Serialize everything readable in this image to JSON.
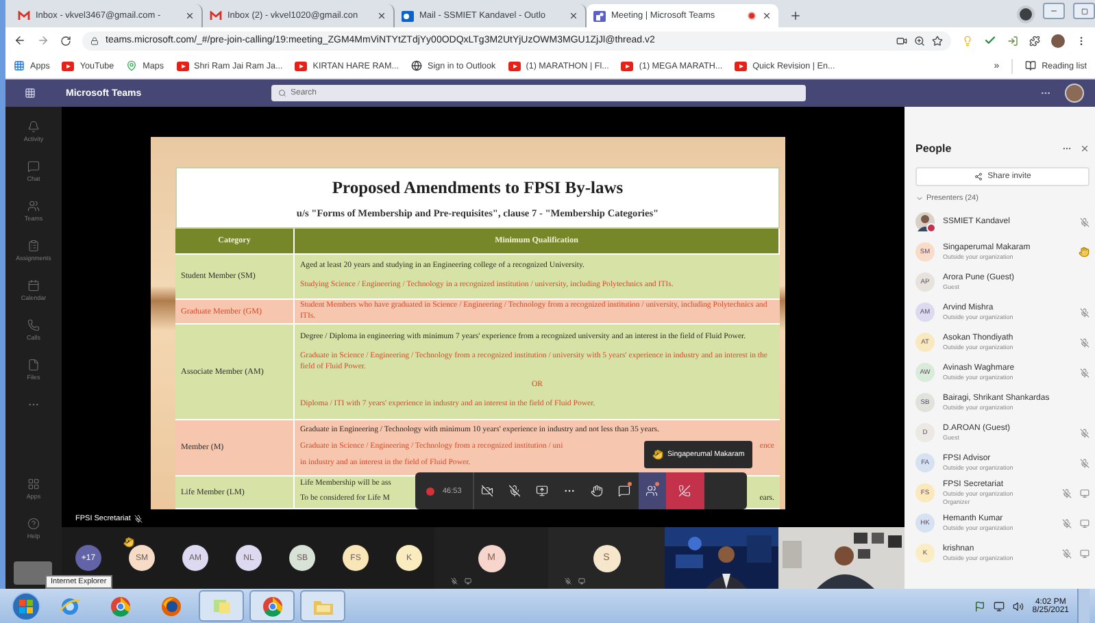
{
  "browser": {
    "tabs": [
      {
        "kind": "mail",
        "title": "Inbox - vkvel3467@gmail.com -",
        "selected": false,
        "recording": false
      },
      {
        "kind": "mail",
        "title": "Inbox (2) - vkvel1020@gmail.con",
        "selected": false,
        "recording": false
      },
      {
        "kind": "outlook",
        "title": "Mail - SSMIET Kandavel - Outlo",
        "selected": false,
        "recording": false
      },
      {
        "kind": "teams",
        "title": "Meeting | Microsoft Teams",
        "selected": true,
        "recording": true
      }
    ],
    "url": "teams.microsoft.com/_#/pre-join-calling/19:meeting_ZGM4MmViNTYtZTdjYy00ODQxLTg3M2UtYjUzOWM3MGU1ZjJl@thread.v2",
    "bookmarks": [
      {
        "kind": "apps",
        "label": "Apps"
      },
      {
        "kind": "youtube",
        "label": "YouTube"
      },
      {
        "kind": "maps",
        "label": "Maps"
      },
      {
        "kind": "youtube",
        "label": "Shri Ram Jai Ram Ja..."
      },
      {
        "kind": "youtube",
        "label": "KIRTAN HARE RAM..."
      },
      {
        "kind": "globe",
        "label": "Sign in to Outlook"
      },
      {
        "kind": "youtube",
        "label": "(1) MARATHON | Fl..."
      },
      {
        "kind": "youtube",
        "label": "(1) MEGA MARATH..."
      },
      {
        "kind": "youtube",
        "label": "Quick Revision | En..."
      }
    ],
    "overflow": "»",
    "reading_list": "Reading list"
  },
  "teams": {
    "app_name": "Microsoft Teams",
    "search_placeholder": "Search"
  },
  "rail": {
    "top": [
      {
        "kind": "activity",
        "label": "Activity"
      },
      {
        "kind": "chat",
        "label": "Chat"
      },
      {
        "kind": "teams",
        "label": "Teams"
      },
      {
        "kind": "assignments",
        "label": "Assignments"
      },
      {
        "kind": "calendar",
        "label": "Calendar"
      },
      {
        "kind": "calls",
        "label": "Calls"
      },
      {
        "kind": "files",
        "label": "Files"
      },
      {
        "kind": "more"
      }
    ],
    "bottom": [
      {
        "kind": "apps",
        "label": "Apps"
      },
      {
        "kind": "help",
        "label": "Help"
      }
    ]
  },
  "slide": {
    "title": "Proposed Amendments to FPSI By-laws",
    "subtitle": "u/s \"Forms of Membership and Pre-requisites\", clause 7 - \"Membership Categories\"",
    "columns": [
      "Category",
      "Minimum Qualification"
    ],
    "rows": [
      {
        "kind": "current",
        "category": "Student Member (SM)",
        "qualification": [
          {
            "kind": "current",
            "text": "Aged at least 20 years and studying in an Engineering college of a recognized University."
          },
          {
            "kind": "proposed",
            "text": "Studying Science / Engineering / Technology in a recognized institution / university, including Polytechnics and ITIs."
          }
        ]
      },
      {
        "kind": "proposed",
        "category": "Graduate Member (GM)",
        "qualification": [
          {
            "kind": "proposed",
            "text": "Student Members who have graduated in Science / Engineering / Technology from a recognized institution / university, including Polytechnics and ITIs."
          }
        ]
      },
      {
        "kind": "current",
        "category": "Associate Member (AM)",
        "qualification": [
          {
            "kind": "current",
            "text": "Degree / Diploma in engineering with minimum 7 years' experience from a recognized university and an interest in the field of Fluid Power."
          },
          {
            "kind": "proposed",
            "text": "Graduate in Science / Engineering / Technology from a recognized institution / university with 5 years' experience in industry and an interest in the field of Fluid Power."
          },
          {
            "kind": "separator",
            "text": "OR"
          },
          {
            "kind": "proposed",
            "text": "Diploma / ITI with 7 years' experience in industry and an interest in the field of Fluid Power."
          }
        ]
      },
      {
        "kind": "current",
        "category": "Member (M)",
        "qualification": [
          {
            "kind": "current",
            "text": "Graduate in Engineering / Technology with minimum 10 years' experience in industry and not less than 35 years."
          },
          {
            "kind": "proposed",
            "text": "Graduate in Science / Engineering / Technology from a recognized institution / uni",
            "tail": "ence"
          },
          {
            "kind": "proposed",
            "text": "in industry and an interest in the field of Fluid Power."
          }
        ]
      },
      {
        "kind": "current",
        "category": "Life Member (LM)",
        "qualification": [
          {
            "kind": "current",
            "text": "Life Membership will be ass"
          },
          {
            "kind": "current",
            "text": "To be considered for Life M",
            "tail": "ears."
          }
        ]
      }
    ]
  },
  "controls": {
    "timer": "46:53",
    "buttons": [
      {
        "kind": "camera_off",
        "selected": false,
        "notification": false
      },
      {
        "kind": "mic_off",
        "selected": false,
        "notification": false
      },
      {
        "kind": "share",
        "selected": false,
        "notification": false
      },
      {
        "kind": "more",
        "selected": false,
        "notification": false
      },
      {
        "kind": "raise_hand",
        "selected": false,
        "notification": false
      },
      {
        "kind": "chat",
        "selected": false,
        "notification": true
      },
      {
        "kind": "people",
        "selected": true,
        "notification": true
      },
      {
        "kind": "hang_up",
        "selected": false,
        "notification": false
      }
    ]
  },
  "tooltip": {
    "text": "Singaperumal Makaram"
  },
  "speaker": {
    "name": "FPSI Secretariat",
    "muted": true
  },
  "strip": {
    "overflow": "+17",
    "avatars": [
      {
        "initials": "SM",
        "color": "#f6dcc6",
        "hand_raised": true
      },
      {
        "initials": "AM",
        "color": "#dcd9f0",
        "hand_raised": false
      },
      {
        "initials": "NL",
        "color": "#dcd9f0",
        "hand_raised": false
      },
      {
        "initials": "SB",
        "color": "#d9e2d6",
        "hand_raised": false
      },
      {
        "initials": "FS",
        "color": "#f8e6b8",
        "hand_raised": false
      },
      {
        "initials": "K",
        "color": "#fbecc0",
        "hand_raised": false
      }
    ],
    "tiles": [
      {
        "kind": "avatar",
        "initials": "M",
        "color": "#f5d5cc"
      },
      {
        "kind": "avatar",
        "initials": "S",
        "color": "#f6e7cc"
      },
      {
        "kind": "picture"
      },
      {
        "kind": "picture"
      }
    ]
  },
  "people": {
    "title": "People",
    "share_label": "Share invite",
    "section": "Presenters (24)",
    "expanded": true,
    "members": [
      {
        "name": "SSMIET Kandavel",
        "muted": true,
        "hand_raised": false,
        "video_tile": false
      },
      {
        "kind": "initials",
        "initials": "SM",
        "color": "#f8dcc8",
        "name": "Singaperumal Makaram",
        "details": [
          "Outside your organization"
        ],
        "muted": false,
        "hand_raised": true,
        "video_tile": false
      },
      {
        "kind": "initials",
        "initials": "AP",
        "color": "#e8e2dc",
        "name": "Arora Pune (Guest)",
        "details": [
          "Guest"
        ],
        "muted": false,
        "hand_raised": false,
        "video_tile": false
      },
      {
        "kind": "initials",
        "initials": "AM",
        "color": "#ddd9f0",
        "name": "Arvind Mishra",
        "details": [
          "Outside your organization"
        ],
        "muted": true,
        "hand_raised": false,
        "video_tile": false
      },
      {
        "kind": "initials",
        "initials": "AT",
        "color": "#fae9bf",
        "name": "Asokan Thondiyath",
        "details": [
          "Outside your organization"
        ],
        "muted": true,
        "hand_raised": false,
        "video_tile": false
      },
      {
        "kind": "initials",
        "initials": "AW",
        "color": "#d8ecd9",
        "name": "Avinash Waghmare",
        "details": [
          "Outside your organization"
        ],
        "muted": true,
        "hand_raised": false,
        "video_tile": false
      },
      {
        "kind": "initials",
        "initials": "SB",
        "color": "#dfe3dc",
        "name": "Bairagi, Shrikant Shankardas",
        "details": [
          "Outside your organization"
        ],
        "muted": false,
        "hand_raised": false,
        "video_tile": false
      },
      {
        "kind": "initials",
        "initials": "D",
        "color": "#ece9e4",
        "name": "D.AROAN (Guest)",
        "details": [
          "Guest"
        ],
        "muted": true,
        "hand_raised": false,
        "video_tile": false
      },
      {
        "kind": "initials",
        "initials": "FA",
        "color": "#d6e1f2",
        "name": "FPSI Advisor",
        "details": [
          "Outside your organization"
        ],
        "muted": true,
        "hand_raised": false,
        "video_tile": false
      },
      {
        "kind": "initials",
        "initials": "FS",
        "color": "#fbe8bd",
        "name": "FPSI Secretariat",
        "details": [
          "Outside your organization",
          "Organizer"
        ],
        "muted": true,
        "hand_raised": false,
        "video_tile": true
      },
      {
        "kind": "initials",
        "initials": "HK",
        "color": "#d6e1f2",
        "name": "Hemanth Kumar",
        "details": [
          "Outside your organization"
        ],
        "muted": true,
        "hand_raised": false,
        "video_tile": true
      },
      {
        "kind": "initials",
        "initials": "K",
        "color": "#fbedc3",
        "name": "krishnan",
        "details": [
          "Outside your organization"
        ],
        "muted": true,
        "hand_raised": false,
        "video_tile": true
      }
    ]
  },
  "taskbar": {
    "apps": [
      {
        "kind": "ie",
        "running": false
      },
      {
        "kind": "chrome",
        "running": false
      },
      {
        "kind": "firefox",
        "running": false
      },
      {
        "kind": "notes",
        "running": true
      },
      {
        "kind": "chrome",
        "running": true
      },
      {
        "kind": "explorer",
        "running": true
      }
    ],
    "tooltip": "Internet Explorer",
    "time": "4:02 PM",
    "date": "8/25/2021"
  }
}
